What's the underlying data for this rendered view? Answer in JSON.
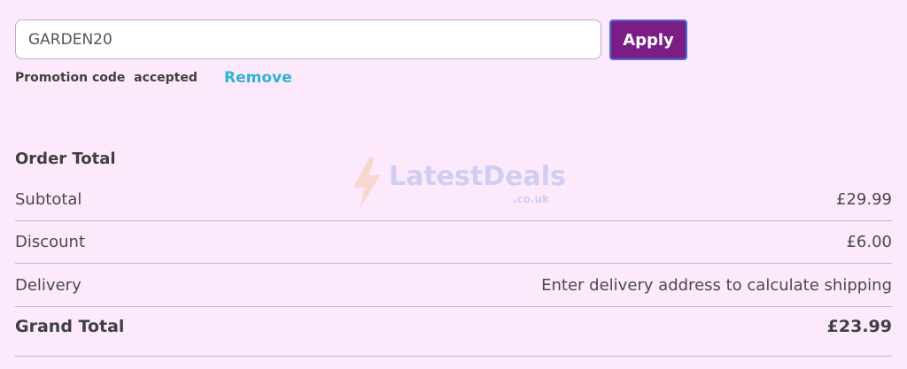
{
  "promo": {
    "code_value": "GARDEN20",
    "apply_label": "Apply",
    "status_text": "Promotion code  accepted",
    "remove_label": "Remove"
  },
  "watermark": {
    "brand": "LatestDeals",
    "domain": ".co.uk"
  },
  "order": {
    "title": "Order Total",
    "rows": [
      {
        "label": "Subtotal",
        "value": "£29.99"
      },
      {
        "label": "Discount",
        "value": "£6.00"
      },
      {
        "label": "Delivery",
        "value": "Enter delivery address to calculate shipping"
      },
      {
        "label": "Grand Total",
        "value": "£23.99"
      }
    ]
  },
  "colors": {
    "background": "#fce9fc",
    "apply_button": "#7a1e86",
    "remove_link": "#2fb3d3"
  }
}
